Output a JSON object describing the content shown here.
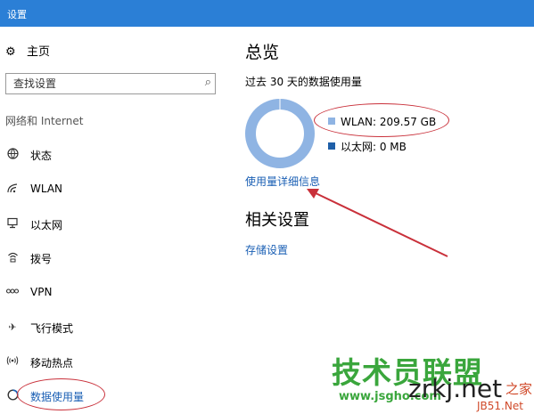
{
  "window": {
    "title": "设置"
  },
  "sidebar": {
    "home": {
      "icon": "gear-icon",
      "label": "主页"
    },
    "search": {
      "placeholder": "查找设置",
      "icon": "search-icon"
    },
    "section_title": "网络和 Internet",
    "items": [
      {
        "icon": "globe-icon",
        "label": "状态"
      },
      {
        "icon": "wifi-icon",
        "label": "WLAN"
      },
      {
        "icon": "ethernet-icon",
        "label": "以太网"
      },
      {
        "icon": "dialup-icon",
        "label": "拨号"
      },
      {
        "icon": "vpn-icon",
        "label": "VPN"
      },
      {
        "icon": "airplane-icon",
        "label": "飞行模式"
      },
      {
        "icon": "hotspot-icon",
        "label": "移动热点"
      },
      {
        "icon": "data-usage-icon",
        "label": "数据使用量",
        "selected": true
      }
    ]
  },
  "main": {
    "overview": {
      "title": "总览",
      "period": "过去 30 天的数据使用量",
      "usage": [
        {
          "label": "WLAN: 209.57 GB",
          "value_gb": 209.57,
          "color": "#8fb4e3"
        },
        {
          "label": "以太网: 0 MB",
          "value_gb": 0,
          "color": "#1f5fa8"
        }
      ],
      "details_link": "使用量详细信息"
    },
    "related": {
      "title": "相关设置",
      "storage_link": "存储设置"
    }
  },
  "watermark": {
    "line1": "技术员联盟",
    "line2": "www.jsgho.com",
    "line3": "zrkj.net",
    "line4": "之家",
    "line5": "JB51.Net"
  }
}
